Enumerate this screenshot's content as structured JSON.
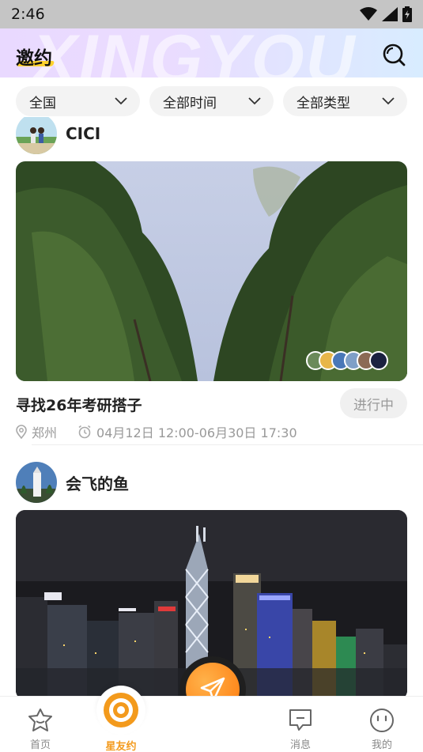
{
  "status_bar": {
    "time": "2:46"
  },
  "header": {
    "title": "邀约",
    "watermark": "XINGYOU"
  },
  "filters": [
    {
      "label": "全国"
    },
    {
      "label": "全部时间"
    },
    {
      "label": "全部类型"
    }
  ],
  "posts": [
    {
      "username": "CICI",
      "title": "寻找26年考研搭子",
      "location": "郑州",
      "time": "04月12日 12:00-06月30日 17:30",
      "status": "进行中"
    },
    {
      "username": "会飞的鱼"
    }
  ],
  "tabbar": {
    "items": [
      {
        "label": "首页",
        "icon": "home-icon"
      },
      {
        "label": "星友约",
        "icon": "planet-icon",
        "active": true
      },
      {
        "label": "消息",
        "icon": "message-icon"
      },
      {
        "label": "我的",
        "icon": "smile-icon"
      }
    ],
    "center_icon": "paper-plane-icon"
  },
  "colors": {
    "accent": "#f39a1c",
    "title_highlight": "#ffd22e"
  }
}
